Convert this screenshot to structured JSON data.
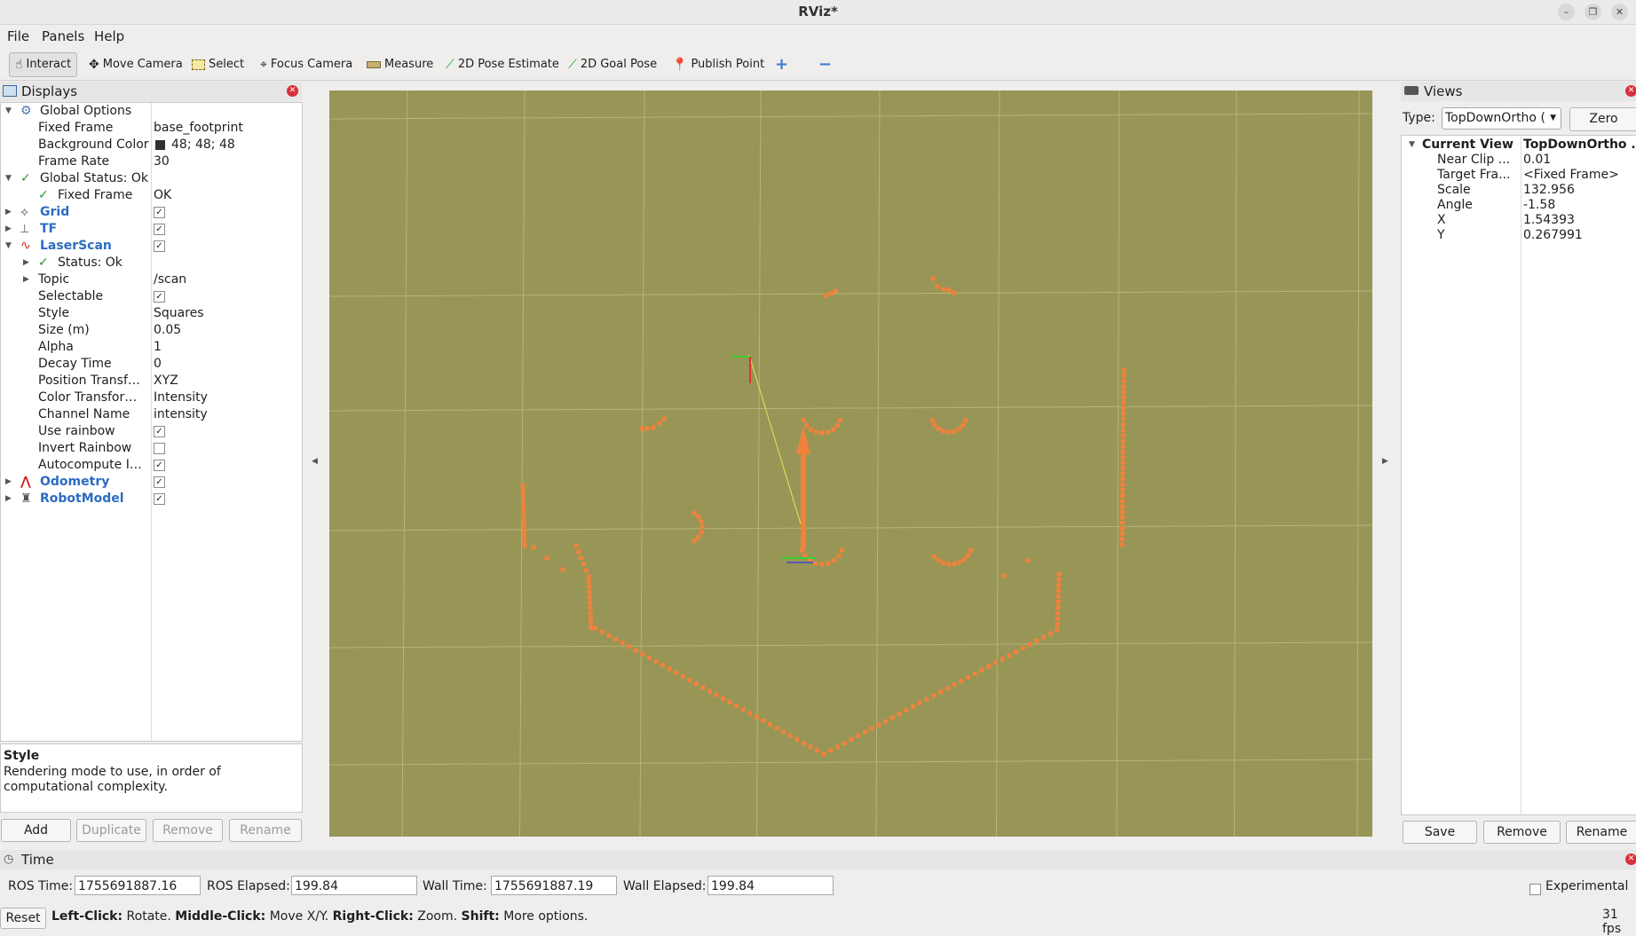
{
  "window": {
    "title": "RViz*"
  },
  "menu": [
    "File",
    "Panels",
    "Help"
  ],
  "toolbar": [
    {
      "label": "Interact",
      "icon": "hand-cursor-icon",
      "active": true
    },
    {
      "label": "Move Camera",
      "icon": "move-camera-icon"
    },
    {
      "label": "Select",
      "icon": "select-rectangle-icon"
    },
    {
      "label": "Focus Camera",
      "icon": "focus-camera-icon"
    },
    {
      "label": "Measure",
      "icon": "ruler-icon"
    },
    {
      "label": "2D Pose Estimate",
      "icon": "green-arrow-icon"
    },
    {
      "label": "2D Goal Pose",
      "icon": "green-arrow-icon"
    },
    {
      "label": "Publish Point",
      "icon": "map-pin-icon"
    }
  ],
  "displays": {
    "title": "Displays",
    "rows": [
      {
        "name": "Global Options"
      },
      {
        "name": "Fixed Frame",
        "value": "base_footprint"
      },
      {
        "name": "Background Color",
        "value": "48; 48; 48"
      },
      {
        "name": "Frame Rate",
        "value": "30"
      },
      {
        "name": "Global Status: Ok"
      },
      {
        "name": "Fixed Frame",
        "value": "OK"
      },
      {
        "name": "Grid"
      },
      {
        "name": "TF"
      },
      {
        "name": "LaserScan"
      },
      {
        "name": "Status: Ok"
      },
      {
        "name": "Topic",
        "value": "/scan"
      },
      {
        "name": "Selectable"
      },
      {
        "name": "Style",
        "value": "Squares"
      },
      {
        "name": "Size (m)",
        "value": "0.05"
      },
      {
        "name": "Alpha",
        "value": "1"
      },
      {
        "name": "Decay Time",
        "value": "0"
      },
      {
        "name": "Position Transf…",
        "value": "XYZ"
      },
      {
        "name": "Color Transfor…",
        "value": "Intensity"
      },
      {
        "name": "Channel Name",
        "value": "intensity"
      },
      {
        "name": "Use rainbow"
      },
      {
        "name": "Invert Rainbow"
      },
      {
        "name": "Autocompute I…"
      },
      {
        "name": "Odometry"
      },
      {
        "name": "RobotModel"
      }
    ],
    "help_title": "Style",
    "help_text": "Rendering mode to use, in order of computational complexity.",
    "buttons": [
      "Add",
      "Duplicate",
      "Remove",
      "Rename"
    ]
  },
  "views": {
    "title": "Views",
    "type_label": "Type:",
    "type_value": "TopDownOrtho (",
    "zero_label": "Zero",
    "current_view_label": "Current View",
    "current_view_value": "TopDownOrtho ...",
    "props": [
      {
        "name": "Near Clip ...",
        "value": "0.01"
      },
      {
        "name": "Target Fra...",
        "value": "<Fixed Frame>"
      },
      {
        "name": "Scale",
        "value": "132.956"
      },
      {
        "name": "Angle",
        "value": "-1.58"
      },
      {
        "name": "X",
        "value": "1.54393"
      },
      {
        "name": "Y",
        "value": "0.267991"
      }
    ],
    "buttons": [
      "Save",
      "Remove",
      "Rename"
    ]
  },
  "time": {
    "title": "Time",
    "ros_time_label": "ROS Time:",
    "ros_time": "1755691887.16",
    "ros_elapsed_label": "ROS Elapsed:",
    "ros_elapsed": "199.84",
    "wall_time_label": "Wall Time:",
    "wall_time": "1755691887.19",
    "wall_elapsed_label": "Wall Elapsed:",
    "wall_elapsed": "199.84",
    "experimental_label": "Experimental"
  },
  "status": {
    "reset_label": "Reset",
    "left_click": "Left-Click:",
    "left_click_desc": "Rotate.",
    "middle_click": "Middle-Click:",
    "middle_click_desc": "Move X/Y.",
    "right_click": "Right-Click:",
    "right_click_desc": "Zoom.",
    "shift": "Shift:",
    "shift_desc": "More options.",
    "fps": "31 fps"
  },
  "colors": {
    "viewport_bg": "#979656",
    "laser": "#f0823c",
    "grid": "#b9b88a"
  }
}
